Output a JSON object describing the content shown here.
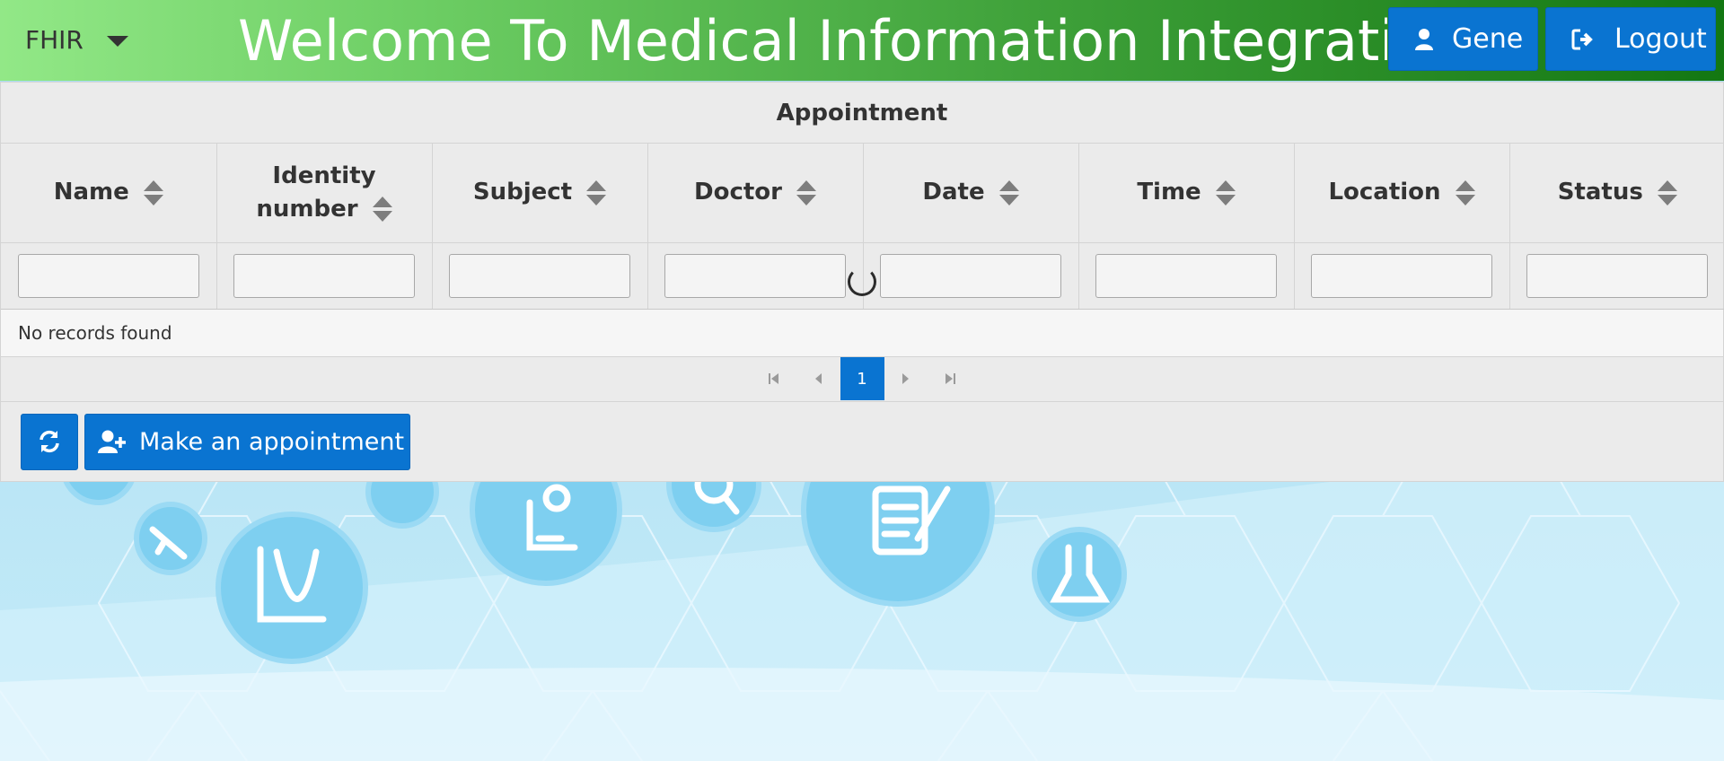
{
  "header": {
    "brand": "FHIR",
    "title": "Welcome To Medical Information Integration System",
    "user_button": "Gene",
    "logout_button": "Logout",
    "gradient": [
      "#92e887",
      "#137712"
    ]
  },
  "panel": {
    "title": "Appointment",
    "columns": [
      {
        "label": "Name"
      },
      {
        "label": "Identity number"
      },
      {
        "label": "Subject"
      },
      {
        "label": "Doctor"
      },
      {
        "label": "Date"
      },
      {
        "label": "Time"
      },
      {
        "label": "Location"
      },
      {
        "label": "Status"
      }
    ],
    "filters": [
      "",
      "",
      "",
      "",
      "",
      "",
      "",
      ""
    ],
    "empty_message": "No records found",
    "pagination": {
      "current_page": "1"
    },
    "toolbar": {
      "refresh_icon": "refresh-icon",
      "make_label": "Make an appointment",
      "make_icon": "user-plus-icon"
    }
  },
  "colors": {
    "accent": "#0a74d1",
    "panel_bg": "#ebebeb",
    "background": "#a9dff3"
  }
}
